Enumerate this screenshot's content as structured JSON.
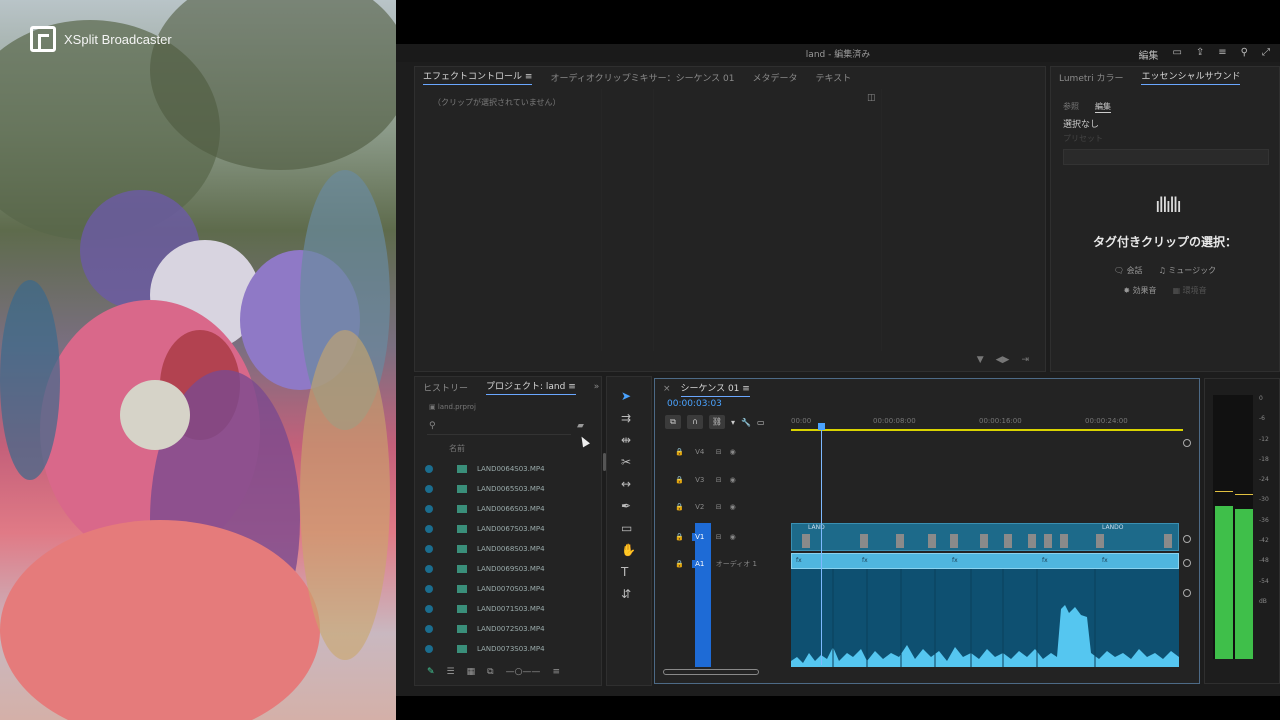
{
  "overlay": {
    "brand": "XSplit Broadcaster"
  },
  "window": {
    "title": "land - 編集済み",
    "icons": [
      "編集",
      "panel-icon",
      "export-icon",
      "menu-icon",
      "search-icon",
      "fullscreen-icon"
    ]
  },
  "effect_controls": {
    "tabs": [
      "エフェクトコントロール",
      "オーディオクリップミキサー：シーケンス 01",
      "メタデータ",
      "テキスト"
    ],
    "active_tab": 0,
    "menu_glyph": "≡",
    "empty_message": "（クリップが選択されていません）"
  },
  "essential_sound": {
    "tabs": [
      "Lumetri カラー",
      "エッセンシャルサウンド"
    ],
    "sub_tabs": [
      "参照",
      "編集"
    ],
    "no_selection": "選択なし",
    "preset_label": "プリセット",
    "heading": "タグ付きクリップの選択：",
    "types_row1": [
      "会話",
      "ミュージック"
    ],
    "types_row2": [
      "効果音",
      "環境音"
    ]
  },
  "project": {
    "tabs": [
      "ヒストリー",
      "プロジェクト: land"
    ],
    "active_tab": 1,
    "filename": "land.prproj",
    "column_name": "名前",
    "items": [
      "LAND0064S03.MP4",
      "LAND0065S03.MP4",
      "LAND0066S03.MP4",
      "LAND0067S03.MP4",
      "LAND0068S03.MP4",
      "LAND0069S03.MP4",
      "LAND0070S03.MP4",
      "LAND0071S03.MP4",
      "LAND0072S03.MP4",
      "LAND0073S03.MP4"
    ]
  },
  "timeline": {
    "tab": "シーケンス 01",
    "timecode": "00:00:03:03",
    "ruler": [
      "00:00",
      "00:00:08:00",
      "00:00:16:00",
      "00:00:24:00"
    ],
    "tracks": [
      "V4",
      "V3",
      "V2",
      "V1",
      "A1"
    ],
    "audio_track_name": "オーディオ 1",
    "clip_label_1": "LAND",
    "clip_label_2": "LANDO"
  },
  "meter": {
    "scale": [
      "0",
      "-6",
      "-12",
      "-18",
      "-24",
      "-30",
      "-36",
      "-42",
      "-48",
      "-54",
      "dB"
    ],
    "left_level": 0.58,
    "right_level": 0.57,
    "colors": {
      "meter": "#3fbf4a",
      "peak": "#e0c040",
      "accent": "#4aa3ff"
    }
  }
}
